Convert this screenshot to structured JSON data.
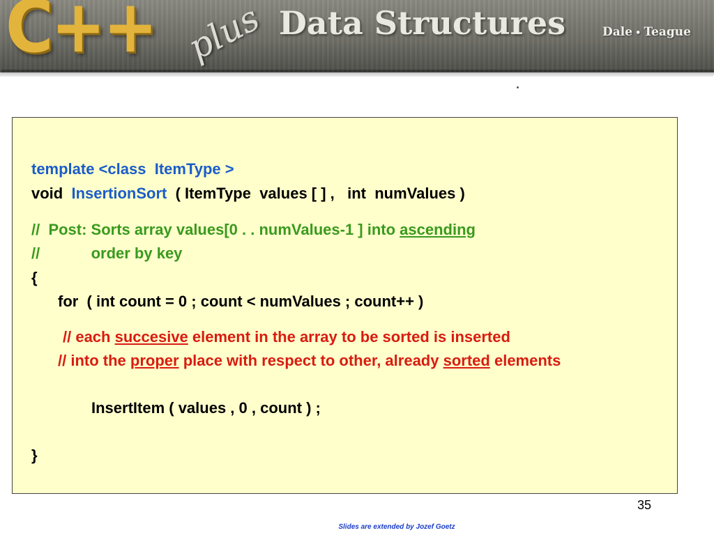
{
  "header": {
    "logo_cpp": "C++",
    "logo_plus": "plus",
    "title": "Data Structures",
    "author1": "Dale",
    "author_sep": "•",
    "author2": "Teague"
  },
  "code": {
    "l1": "template <class  ItemType >",
    "l2_kw": "void  ",
    "l2_fn": "InsertionSort",
    "l2_rest": "  ( ItemType  values [ ] ,   int  numValues )",
    "l3_a": "//  Post: Sorts array values[0 . . numValues-1 ] into ",
    "l3_u": "ascending",
    "l4": "//            order by key",
    "l5": "{",
    "l6": "for  ( int count = 0 ; count < numValues ; count++ )",
    "l7_a": "// each ",
    "l7_u": "succesive",
    "l7_b": " element in the array to be sorted is inserted",
    "l8_a": "// into the ",
    "l8_u1": "proper",
    "l8_b": " place with respect to other, already ",
    "l8_u2": "sorted",
    "l8_c": " elements",
    "l9": "InsertItem ( values , 0 , count ) ;",
    "l10": "}"
  },
  "slide_number": "35",
  "footer": "Slides are extended by Jozef Goetz"
}
